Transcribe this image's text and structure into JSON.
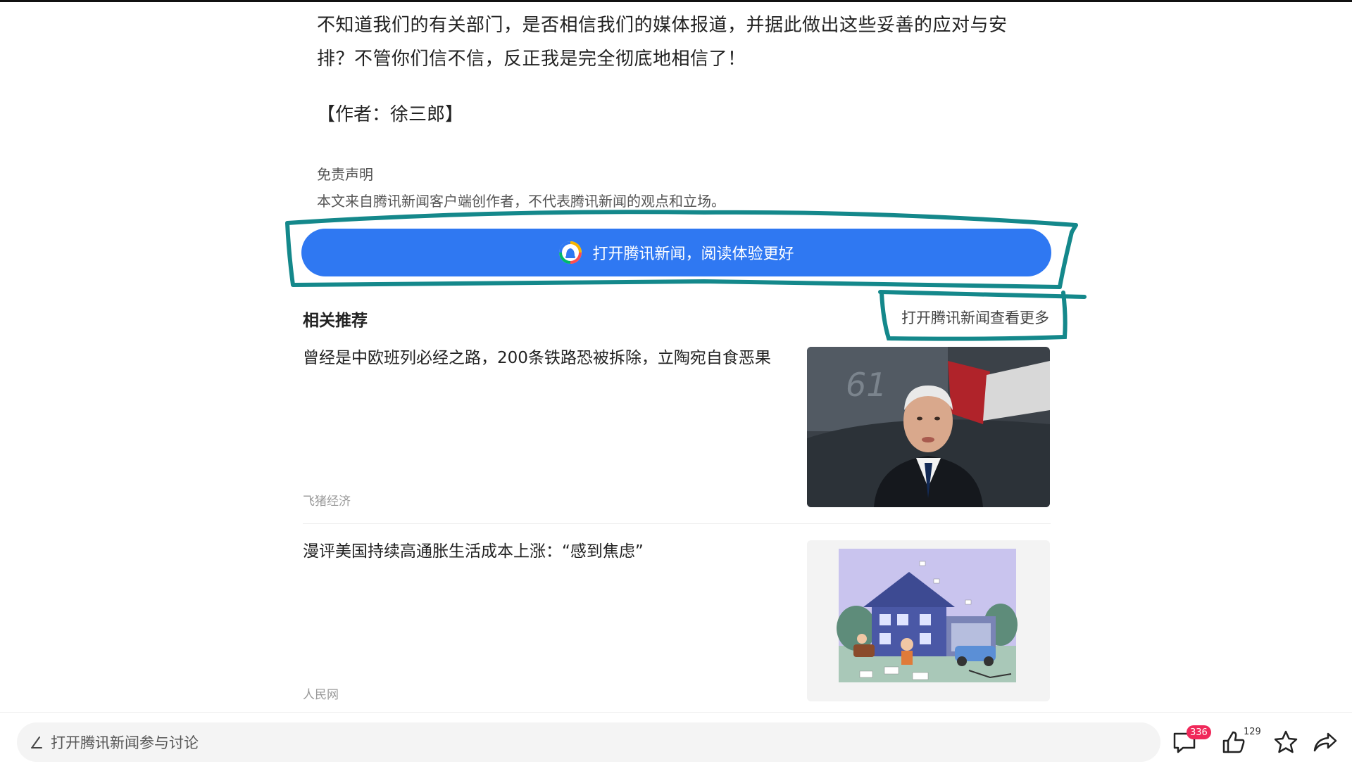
{
  "article": {
    "paragraph": "不知道我们的有关部门，是否相信我们的媒体报道，并据此做出这些妥善的应对与安排？不管你们信不信，反正我是完全彻底地相信了！",
    "paragraph_line1": "不知道我们的有关部门，是否相信我们的媒体报道，并据此做出这些妥善的应对与安",
    "paragraph_line2": "排？不管你们信不信，反正我是完全彻底地相信了！",
    "author": "【作者：徐三郎】",
    "disclaimer_title": "免责声明",
    "disclaimer_text": "本文来自腾讯新闻客户端创作者，不代表腾讯新闻的观点和立场。"
  },
  "open_app_button": {
    "label": "打开腾讯新闻，阅读体验更好",
    "icon": "tencent-news-logo-icon"
  },
  "related": {
    "title": "相关推荐",
    "more_link": "打开腾讯新闻查看更多",
    "items": [
      {
        "title": "曾经是中欧班列必经之路，200条铁路恐被拆除，立陶宛自食恶果",
        "source": "飞猪经济",
        "thumbnail": "photo-man-in-suit"
      },
      {
        "title": "漫评美国持续高通胀生活成本上涨：“感到焦虑”",
        "source": "人民网",
        "thumbnail": "cartoon-house-illustration"
      }
    ]
  },
  "bottom_bar": {
    "comment_placeholder": "打开腾讯新闻参与讨论",
    "comment_count": "336",
    "like_count": "129",
    "icons": [
      "pen-icon",
      "comment-icon",
      "thumb-up-icon",
      "star-icon",
      "share-icon"
    ]
  },
  "colors": {
    "accent_blue": "#2f78f2",
    "annotation_teal": "#14888b",
    "badge_red": "#f0285a"
  }
}
